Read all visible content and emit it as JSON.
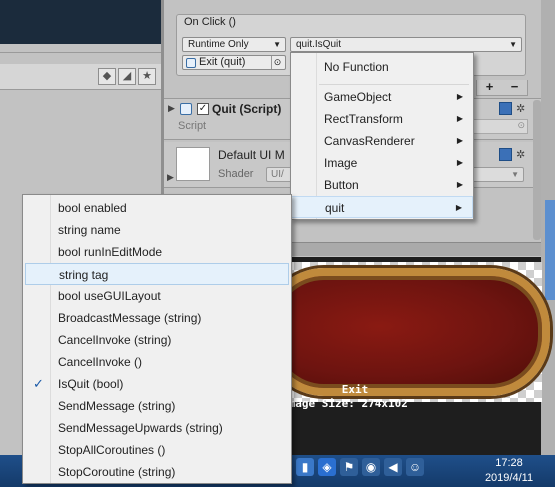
{
  "on_click": {
    "title": "On Click ()",
    "runtime_dropdown": "Runtime Only",
    "function_dropdown": "quit.IsQuit",
    "object_field": "Exit (quit)",
    "add_label": "+",
    "remove_label": "−"
  },
  "quit_component": {
    "title": "Quit (Script)",
    "script_label": "Script",
    "enabled": true
  },
  "material": {
    "title": "Default UI M",
    "shader_label": "Shader",
    "shader_value": "UI/"
  },
  "function_menu": {
    "items": [
      {
        "label": "No Function",
        "has_sub": false
      },
      {
        "label": "GameObject",
        "has_sub": true
      },
      {
        "label": "RectTransform",
        "has_sub": true
      },
      {
        "label": "CanvasRenderer",
        "has_sub": true
      },
      {
        "label": "Image",
        "has_sub": true
      },
      {
        "label": "Button",
        "has_sub": true
      },
      {
        "label": "quit",
        "has_sub": true
      }
    ]
  },
  "sub_menu": {
    "items": [
      {
        "label": "bool enabled"
      },
      {
        "label": "string name"
      },
      {
        "label": "bool runInEditMode"
      },
      {
        "label": "string tag"
      },
      {
        "label": "bool useGUILayout"
      },
      {
        "label": "BroadcastMessage (string)"
      },
      {
        "label": "CancelInvoke (string)"
      },
      {
        "label": "CancelInvoke ()"
      },
      {
        "label": "IsQuit (bool)",
        "checked": true
      },
      {
        "label": "SendMessage (string)"
      },
      {
        "label": "SendMessageUpwards (string)"
      },
      {
        "label": "StopAllCoroutines ()"
      },
      {
        "label": "StopCoroutine (string)"
      }
    ]
  },
  "preview": {
    "name": "Exit",
    "size": "Image Size: 274x102"
  },
  "taskbar": {
    "time": "17:28",
    "date": "2019/4/11"
  },
  "icons": {
    "fold": "▶",
    "submenu_arrow": "▶",
    "dropdown_arrow": "▼",
    "check": "✓",
    "target": "⊙",
    "gear": "✲"
  },
  "colors": {
    "menu_highlight": "#e5f1fb",
    "taskbar": "#1f4f8a",
    "button_red": "#6e1410"
  }
}
